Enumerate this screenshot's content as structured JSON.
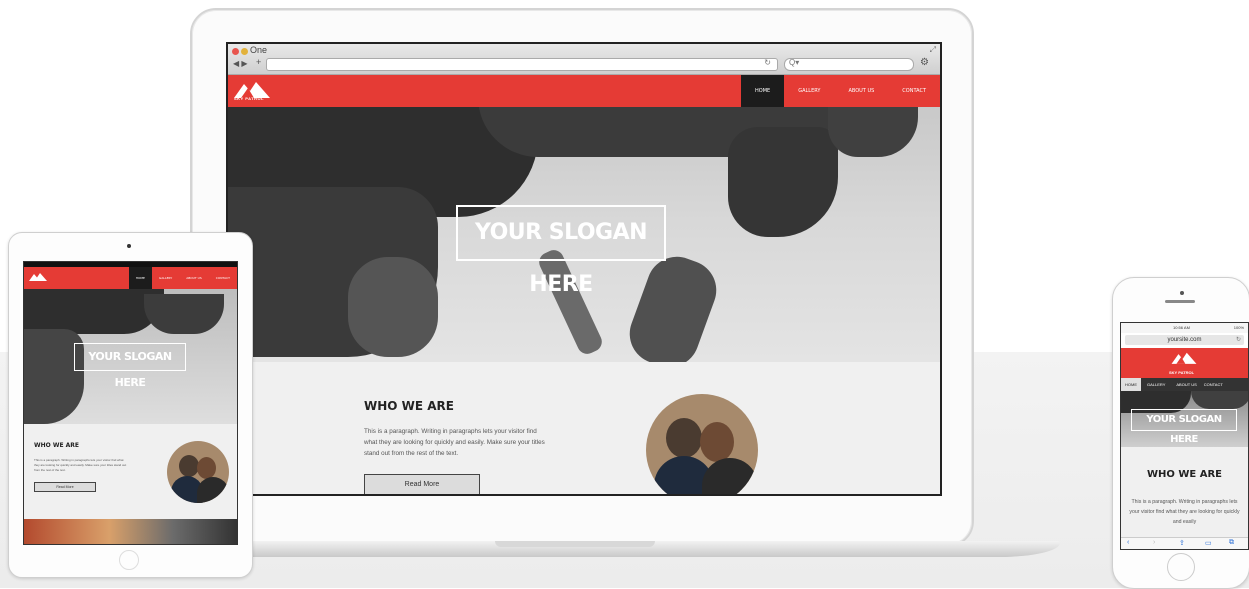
{
  "browser": {
    "tab_title": "One",
    "nav_buttons": "◀ ▶",
    "plus": "+",
    "reload": "↻",
    "search_glyph": "Q▾"
  },
  "site": {
    "logo_text": "SKY PATROL",
    "nav": [
      "HOME",
      "GALLERY",
      "ABOUT US",
      "CONTACT"
    ],
    "slogan": "YOUR SLOGAN HERE",
    "who_title": "WHO WE ARE",
    "paragraph": "This is a paragraph. Writing in paragraphs lets your visitor find what they are looking for quickly and easily. Make sure your titles stand out from the rest of the text.",
    "button": "Read More"
  },
  "phone": {
    "status_time": "10:56 AM",
    "status_battery": "100%",
    "url": "yoursite.com",
    "paragraph_short": "This is a paragraph. Writing in paragraphs lets your visitor find what they are looking for quickly and easily"
  },
  "colors": {
    "brand_red": "#e53b35",
    "active_nav": "#1c1c1c"
  }
}
